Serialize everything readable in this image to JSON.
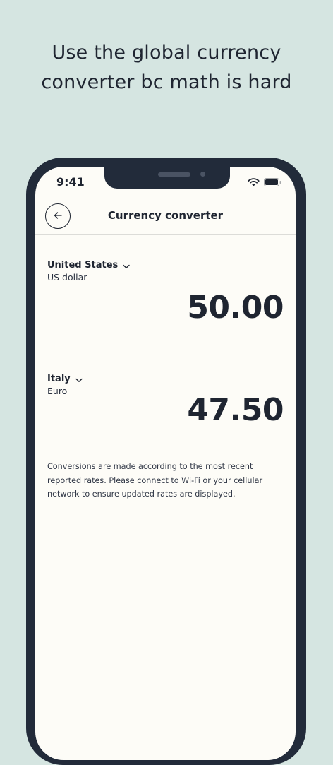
{
  "headline": {
    "line1": "Use the global currency",
    "line2": "converter bc math is hard"
  },
  "status_bar": {
    "time": "9:41",
    "icons": [
      "wifi-icon",
      "battery-icon"
    ]
  },
  "nav": {
    "title": "Currency converter",
    "back_icon": "arrow-left-icon"
  },
  "from_currency": {
    "country": "United States",
    "currency": "US dollar",
    "amount": "50.00"
  },
  "to_currency": {
    "country": "Italy",
    "currency": "Euro",
    "amount": "47.50"
  },
  "disclaimer": "Conversions are made according to the most recent reported rates. Please connect to Wi-Fi or your cellular network to ensure updated rates are displayed.",
  "colors": {
    "background": "#d5e5e1",
    "phone_frame": "#222b3a",
    "screen": "#fdfcf7",
    "text": "#1f2531"
  }
}
